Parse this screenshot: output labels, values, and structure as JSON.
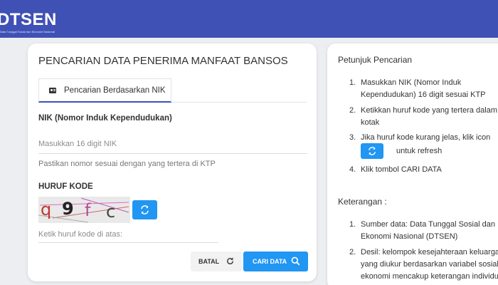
{
  "header": {
    "logo_text": "DTSEN",
    "logo_subtitle": "Data Tunggal Sosial dan Ekonomi Nasional"
  },
  "search_card": {
    "title": "PENCARIAN DATA PENERIMA MANFAAT BANSOS",
    "tab_label": "Pencarian Berdasarkan NIK",
    "nik_label": "NIK (Nomor Induk Kependudukan)",
    "nik_value": "",
    "nik_placeholder": "Masukkan 16 digit NIK",
    "nik_hint": "Pastikan nomor sesuai dengan yang tertera di KTP",
    "kode_label": "HURUF KODE",
    "captcha": {
      "chars": [
        "q",
        "9",
        "f",
        "c"
      ],
      "colors": [
        "#c0392b",
        "#222222",
        "#b84a9c",
        "#444444"
      ]
    },
    "kode_value": "",
    "kode_placeholder": "Ketik huruf kode di atas:",
    "batal_label": "BATAL",
    "cari_label": "CARI DATA"
  },
  "guide": {
    "petunjuk_title": "Petunjuk Pencarian",
    "petunjuk_items": [
      {
        "num": "1.",
        "lines": [
          "Masukkan NIK (Nomor Induk",
          "Kependudukan) 16 digit sesuai KTP"
        ]
      },
      {
        "num": "2.",
        "lines": [
          "Ketikkan huruf kode yang tertera dalam",
          "kotak"
        ]
      },
      {
        "num": "3.",
        "lines": [
          "Jika huruf kode kurang jelas, klik icon",
          "untuk refresh"
        ]
      },
      {
        "num": "4.",
        "lines": [
          "Klik tombol CARI DATA"
        ]
      }
    ],
    "keterangan_title": "Keterangan :",
    "keterangan_items": [
      {
        "num": "1.",
        "lines": [
          "Sumber data: Data Tunggal Sosial dan",
          "Ekonomi Nasional (DTSEN)"
        ]
      },
      {
        "num": "2.",
        "lines": [
          "Desil: kelompok kesejahteraan keluarga",
          "yang diukur berdasarkan variabel sosial",
          "ekonomi mencakup keterangan individu"
        ]
      }
    ]
  },
  "colors": {
    "header": "#3f51b5",
    "primary_button": "#2196f3",
    "background": "#eceef1"
  },
  "icons": [
    "refresh-icon",
    "search-icon",
    "id-card-icon"
  ]
}
